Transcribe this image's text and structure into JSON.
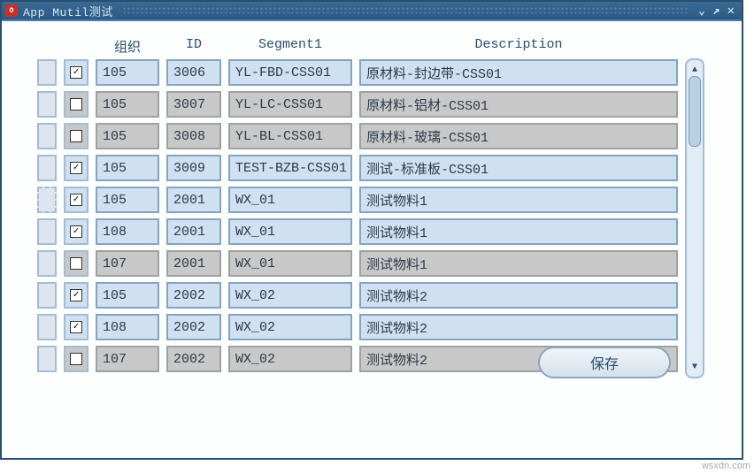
{
  "window": {
    "title": "App Mutil测试"
  },
  "headers": {
    "org": "组织",
    "id": "ID",
    "segment": "Segment1",
    "description": "Description"
  },
  "rows": [
    {
      "checked": true,
      "focused": false,
      "highlight": true,
      "org": "105",
      "id": "3006",
      "segment": "YL-FBD-CSS01",
      "description": "原材料-封边带-CSS01"
    },
    {
      "checked": false,
      "focused": false,
      "highlight": false,
      "org": "105",
      "id": "3007",
      "segment": "YL-LC-CSS01",
      "description": "原材料-铝材-CSS01"
    },
    {
      "checked": false,
      "focused": false,
      "highlight": false,
      "org": "105",
      "id": "3008",
      "segment": "YL-BL-CSS01",
      "description": "原材料-玻璃-CSS01"
    },
    {
      "checked": true,
      "focused": false,
      "highlight": true,
      "org": "105",
      "id": "3009",
      "segment": "TEST-BZB-CSS01",
      "description": "测试-标准板-CSS01"
    },
    {
      "checked": true,
      "focused": true,
      "highlight": true,
      "org": "105",
      "id": "2001",
      "segment": "WX_01",
      "description": "测试物料1"
    },
    {
      "checked": true,
      "focused": false,
      "highlight": true,
      "org": "108",
      "id": "2001",
      "segment": "WX_01",
      "description": "测试物料1"
    },
    {
      "checked": false,
      "focused": false,
      "highlight": false,
      "org": "107",
      "id": "2001",
      "segment": "WX_01",
      "description": "测试物料1"
    },
    {
      "checked": true,
      "focused": false,
      "highlight": true,
      "org": "105",
      "id": "2002",
      "segment": "WX_02",
      "description": "测试物料2"
    },
    {
      "checked": true,
      "focused": false,
      "highlight": true,
      "org": "108",
      "id": "2002",
      "segment": "WX_02",
      "description": "测试物料2"
    },
    {
      "checked": false,
      "focused": false,
      "highlight": false,
      "org": "107",
      "id": "2002",
      "segment": "WX_02",
      "description": "测试物料2"
    }
  ],
  "buttons": {
    "save": "保存"
  },
  "watermark": "wsxdn.com"
}
